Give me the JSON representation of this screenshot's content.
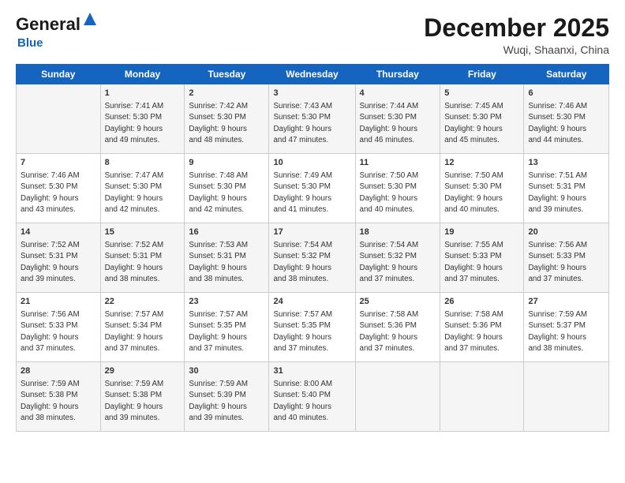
{
  "logo": {
    "general": "General",
    "blue": "Blue"
  },
  "header": {
    "month": "December 2025",
    "location": "Wuqi, Shaanxi, China"
  },
  "weekdays": [
    "Sunday",
    "Monday",
    "Tuesday",
    "Wednesday",
    "Thursday",
    "Friday",
    "Saturday"
  ],
  "weeks": [
    [
      {
        "day": "",
        "sunrise": "",
        "sunset": "",
        "daylight": ""
      },
      {
        "day": "1",
        "sunrise": "Sunrise: 7:41 AM",
        "sunset": "Sunset: 5:30 PM",
        "daylight": "Daylight: 9 hours and 49 minutes."
      },
      {
        "day": "2",
        "sunrise": "Sunrise: 7:42 AM",
        "sunset": "Sunset: 5:30 PM",
        "daylight": "Daylight: 9 hours and 48 minutes."
      },
      {
        "day": "3",
        "sunrise": "Sunrise: 7:43 AM",
        "sunset": "Sunset: 5:30 PM",
        "daylight": "Daylight: 9 hours and 47 minutes."
      },
      {
        "day": "4",
        "sunrise": "Sunrise: 7:44 AM",
        "sunset": "Sunset: 5:30 PM",
        "daylight": "Daylight: 9 hours and 46 minutes."
      },
      {
        "day": "5",
        "sunrise": "Sunrise: 7:45 AM",
        "sunset": "Sunset: 5:30 PM",
        "daylight": "Daylight: 9 hours and 45 minutes."
      },
      {
        "day": "6",
        "sunrise": "Sunrise: 7:46 AM",
        "sunset": "Sunset: 5:30 PM",
        "daylight": "Daylight: 9 hours and 44 minutes."
      }
    ],
    [
      {
        "day": "7",
        "sunrise": "Sunrise: 7:46 AM",
        "sunset": "Sunset: 5:30 PM",
        "daylight": "Daylight: 9 hours and 43 minutes."
      },
      {
        "day": "8",
        "sunrise": "Sunrise: 7:47 AM",
        "sunset": "Sunset: 5:30 PM",
        "daylight": "Daylight: 9 hours and 42 minutes."
      },
      {
        "day": "9",
        "sunrise": "Sunrise: 7:48 AM",
        "sunset": "Sunset: 5:30 PM",
        "daylight": "Daylight: 9 hours and 42 minutes."
      },
      {
        "day": "10",
        "sunrise": "Sunrise: 7:49 AM",
        "sunset": "Sunset: 5:30 PM",
        "daylight": "Daylight: 9 hours and 41 minutes."
      },
      {
        "day": "11",
        "sunrise": "Sunrise: 7:50 AM",
        "sunset": "Sunset: 5:30 PM",
        "daylight": "Daylight: 9 hours and 40 minutes."
      },
      {
        "day": "12",
        "sunrise": "Sunrise: 7:50 AM",
        "sunset": "Sunset: 5:30 PM",
        "daylight": "Daylight: 9 hours and 40 minutes."
      },
      {
        "day": "13",
        "sunrise": "Sunrise: 7:51 AM",
        "sunset": "Sunset: 5:31 PM",
        "daylight": "Daylight: 9 hours and 39 minutes."
      }
    ],
    [
      {
        "day": "14",
        "sunrise": "Sunrise: 7:52 AM",
        "sunset": "Sunset: 5:31 PM",
        "daylight": "Daylight: 9 hours and 39 minutes."
      },
      {
        "day": "15",
        "sunrise": "Sunrise: 7:52 AM",
        "sunset": "Sunset: 5:31 PM",
        "daylight": "Daylight: 9 hours and 38 minutes."
      },
      {
        "day": "16",
        "sunrise": "Sunrise: 7:53 AM",
        "sunset": "Sunset: 5:31 PM",
        "daylight": "Daylight: 9 hours and 38 minutes."
      },
      {
        "day": "17",
        "sunrise": "Sunrise: 7:54 AM",
        "sunset": "Sunset: 5:32 PM",
        "daylight": "Daylight: 9 hours and 38 minutes."
      },
      {
        "day": "18",
        "sunrise": "Sunrise: 7:54 AM",
        "sunset": "Sunset: 5:32 PM",
        "daylight": "Daylight: 9 hours and 37 minutes."
      },
      {
        "day": "19",
        "sunrise": "Sunrise: 7:55 AM",
        "sunset": "Sunset: 5:33 PM",
        "daylight": "Daylight: 9 hours and 37 minutes."
      },
      {
        "day": "20",
        "sunrise": "Sunrise: 7:56 AM",
        "sunset": "Sunset: 5:33 PM",
        "daylight": "Daylight: 9 hours and 37 minutes."
      }
    ],
    [
      {
        "day": "21",
        "sunrise": "Sunrise: 7:56 AM",
        "sunset": "Sunset: 5:33 PM",
        "daylight": "Daylight: 9 hours and 37 minutes."
      },
      {
        "day": "22",
        "sunrise": "Sunrise: 7:57 AM",
        "sunset": "Sunset: 5:34 PM",
        "daylight": "Daylight: 9 hours and 37 minutes."
      },
      {
        "day": "23",
        "sunrise": "Sunrise: 7:57 AM",
        "sunset": "Sunset: 5:35 PM",
        "daylight": "Daylight: 9 hours and 37 minutes."
      },
      {
        "day": "24",
        "sunrise": "Sunrise: 7:57 AM",
        "sunset": "Sunset: 5:35 PM",
        "daylight": "Daylight: 9 hours and 37 minutes."
      },
      {
        "day": "25",
        "sunrise": "Sunrise: 7:58 AM",
        "sunset": "Sunset: 5:36 PM",
        "daylight": "Daylight: 9 hours and 37 minutes."
      },
      {
        "day": "26",
        "sunrise": "Sunrise: 7:58 AM",
        "sunset": "Sunset: 5:36 PM",
        "daylight": "Daylight: 9 hours and 37 minutes."
      },
      {
        "day": "27",
        "sunrise": "Sunrise: 7:59 AM",
        "sunset": "Sunset: 5:37 PM",
        "daylight": "Daylight: 9 hours and 38 minutes."
      }
    ],
    [
      {
        "day": "28",
        "sunrise": "Sunrise: 7:59 AM",
        "sunset": "Sunset: 5:38 PM",
        "daylight": "Daylight: 9 hours and 38 minutes."
      },
      {
        "day": "29",
        "sunrise": "Sunrise: 7:59 AM",
        "sunset": "Sunset: 5:38 PM",
        "daylight": "Daylight: 9 hours and 39 minutes."
      },
      {
        "day": "30",
        "sunrise": "Sunrise: 7:59 AM",
        "sunset": "Sunset: 5:39 PM",
        "daylight": "Daylight: 9 hours and 39 minutes."
      },
      {
        "day": "31",
        "sunrise": "Sunrise: 8:00 AM",
        "sunset": "Sunset: 5:40 PM",
        "daylight": "Daylight: 9 hours and 40 minutes."
      },
      {
        "day": "",
        "sunrise": "",
        "sunset": "",
        "daylight": ""
      },
      {
        "day": "",
        "sunrise": "",
        "sunset": "",
        "daylight": ""
      },
      {
        "day": "",
        "sunrise": "",
        "sunset": "",
        "daylight": ""
      }
    ]
  ]
}
